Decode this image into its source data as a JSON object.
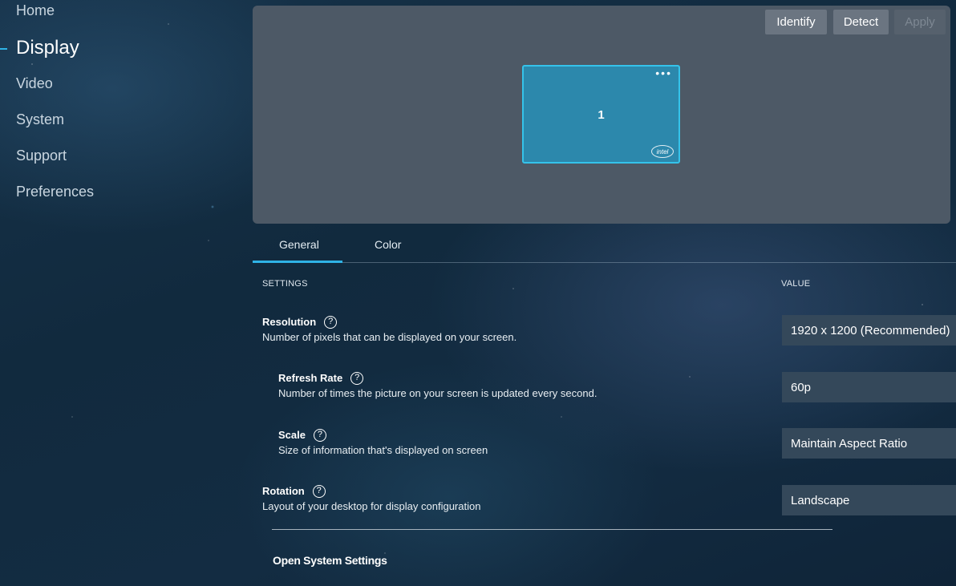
{
  "sidebar": {
    "items": [
      {
        "label": "Home"
      },
      {
        "label": "Display"
      },
      {
        "label": "Video"
      },
      {
        "label": "System"
      },
      {
        "label": "Support"
      },
      {
        "label": "Preferences"
      }
    ],
    "active": "Display"
  },
  "preview": {
    "buttons": {
      "identify": "Identify",
      "detect": "Detect",
      "apply": "Apply"
    },
    "monitor": {
      "number": "1",
      "menu_dots": "•••",
      "logo_text": "intel"
    }
  },
  "tabs": [
    {
      "label": "General",
      "selected": true
    },
    {
      "label": "Color",
      "selected": false
    }
  ],
  "table": {
    "settings_header": "SETTINGS",
    "value_header": "VALUE"
  },
  "settings": [
    {
      "title": "Resolution",
      "description": "Number of pixels that can be displayed on your screen.",
      "value": "1920 x 1200 (Recommended)"
    },
    {
      "title": "Refresh Rate",
      "description": "Number of times the picture on your screen is updated every second.",
      "value": "60p"
    },
    {
      "title": "Scale",
      "description": "Size of information that's displayed on screen",
      "value": "Maintain Aspect Ratio"
    },
    {
      "title": "Rotation",
      "description": "Layout of your desktop for display configuration",
      "value": "Landscape"
    }
  ],
  "help_glyph": "?",
  "open_system_settings": "Open System Settings",
  "colors": {
    "accent": "#2fb3e6",
    "panel": "#4d5966",
    "monitor_fill": "#2c88ac",
    "value_box": "#34485a"
  }
}
